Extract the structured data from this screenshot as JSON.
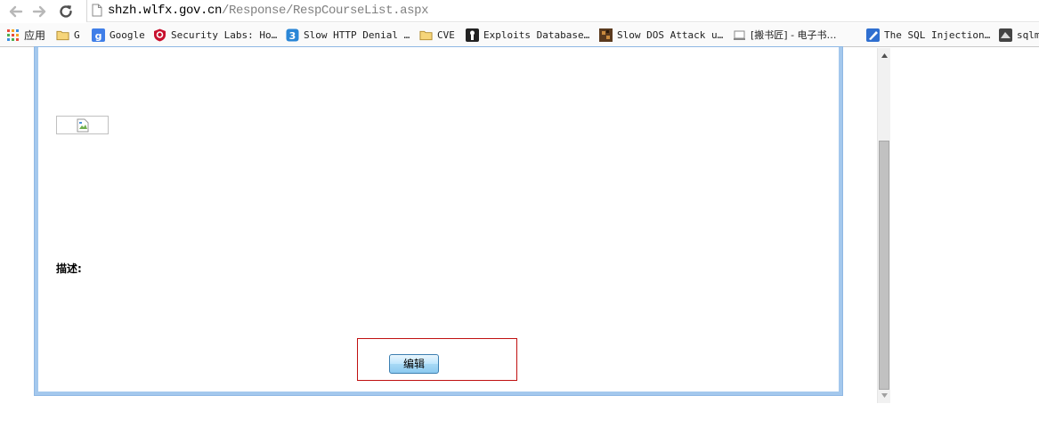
{
  "toolbar": {
    "url_host": "shzh.wlfx.gov.cn",
    "url_path": "/Response/RespCourseList.aspx"
  },
  "bookmarks": [
    {
      "label": "应用",
      "icon": "apps-grid-icon"
    },
    {
      "label": "G",
      "icon": "folder-icon"
    },
    {
      "label": "Google",
      "icon": "google-icon"
    },
    {
      "label": "Security Labs: Ho…",
      "icon": "shield-icon"
    },
    {
      "label": "Slow HTTP Denial …",
      "icon": "blue-badge-icon"
    },
    {
      "label": "CVE",
      "icon": "folder-icon"
    },
    {
      "label": "Exploits Database…",
      "icon": "exploit-db-icon"
    },
    {
      "label": "Slow DOS Attack u…",
      "icon": "pixel-icon"
    },
    {
      "label": "[搬书匠] - 电子书…",
      "icon": "page-icon"
    },
    {
      "label": "The SQL Injection…",
      "icon": "pen-icon"
    },
    {
      "label": "sqlm",
      "icon": "sqlmap-icon"
    }
  ],
  "content": {
    "description_label": "描述:",
    "edit_button_label": "编辑"
  },
  "colors": {
    "frame_border": "#a4c8ed",
    "highlight_border": "#c01010",
    "button_border": "#3c7fb1"
  },
  "scrollbar": {
    "thumb_fraction_visible": 0.72
  }
}
